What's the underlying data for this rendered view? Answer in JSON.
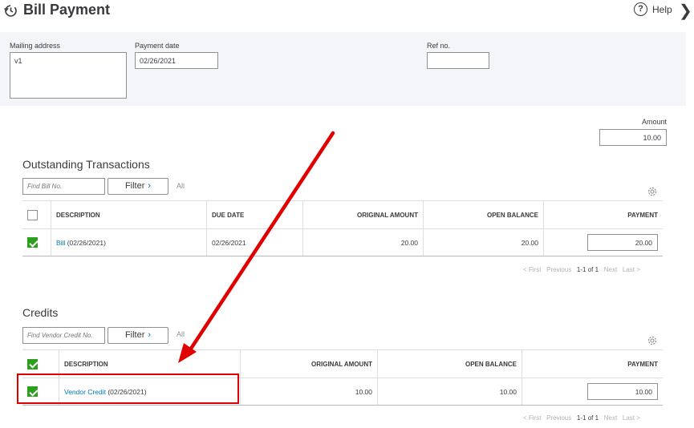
{
  "header": {
    "title": "Bill Payment",
    "help_label": "Help",
    "help_glyph": "?",
    "close_glyph": "❯"
  },
  "form": {
    "mailing_address_label": "Mailing address",
    "mailing_address_value": "v1",
    "payment_date_label": "Payment date",
    "payment_date_value": "02/26/2021",
    "ref_no_label": "Ref no.",
    "ref_no_value": ""
  },
  "amount": {
    "label": "Amount",
    "value": "10.00"
  },
  "outstanding": {
    "title": "Outstanding Transactions",
    "find_placeholder": "Find Bill No.",
    "filter_label": "Filter",
    "all_label": "All",
    "columns": [
      "DESCRIPTION",
      "DUE DATE",
      "ORIGINAL AMOUNT",
      "OPEN BALANCE",
      "PAYMENT"
    ],
    "rows": [
      {
        "checked": true,
        "link_text": "Bill",
        "description_suffix": " (02/26/2021)",
        "due_date": "02/26/2021",
        "original_amount": "20.00",
        "open_balance": "20.00",
        "payment": "20.00"
      }
    ],
    "pager": {
      "first": "< First",
      "previous": "Previous",
      "range": "1-1 of 1",
      "next": "Next",
      "last": "Last >"
    }
  },
  "credits": {
    "title": "Credits",
    "find_placeholder": "Find Vendor Credit No.",
    "filter_label": "Filter",
    "all_label": "All",
    "header_checked": true,
    "columns": [
      "DESCRIPTION",
      "ORIGINAL AMOUNT",
      "OPEN BALANCE",
      "PAYMENT"
    ],
    "rows": [
      {
        "checked": true,
        "link_text": "Vendor Credit",
        "description_suffix": " (02/26/2021)",
        "original_amount": "10.00",
        "open_balance": "10.00",
        "payment": "10.00"
      }
    ],
    "pager": {
      "first": "< First",
      "previous": "Previous",
      "range": "1-1 of 1",
      "next": "Next",
      "last": "Last >"
    }
  },
  "colors": {
    "link": "#0077c5",
    "check_green": "#2ca01c",
    "annotation_red": "#e00000"
  },
  "icons": {
    "history": "history-clock-icon",
    "help": "help-circle-icon",
    "settings": "gear-icon",
    "filter_chevron": "chevron-right-icon"
  }
}
